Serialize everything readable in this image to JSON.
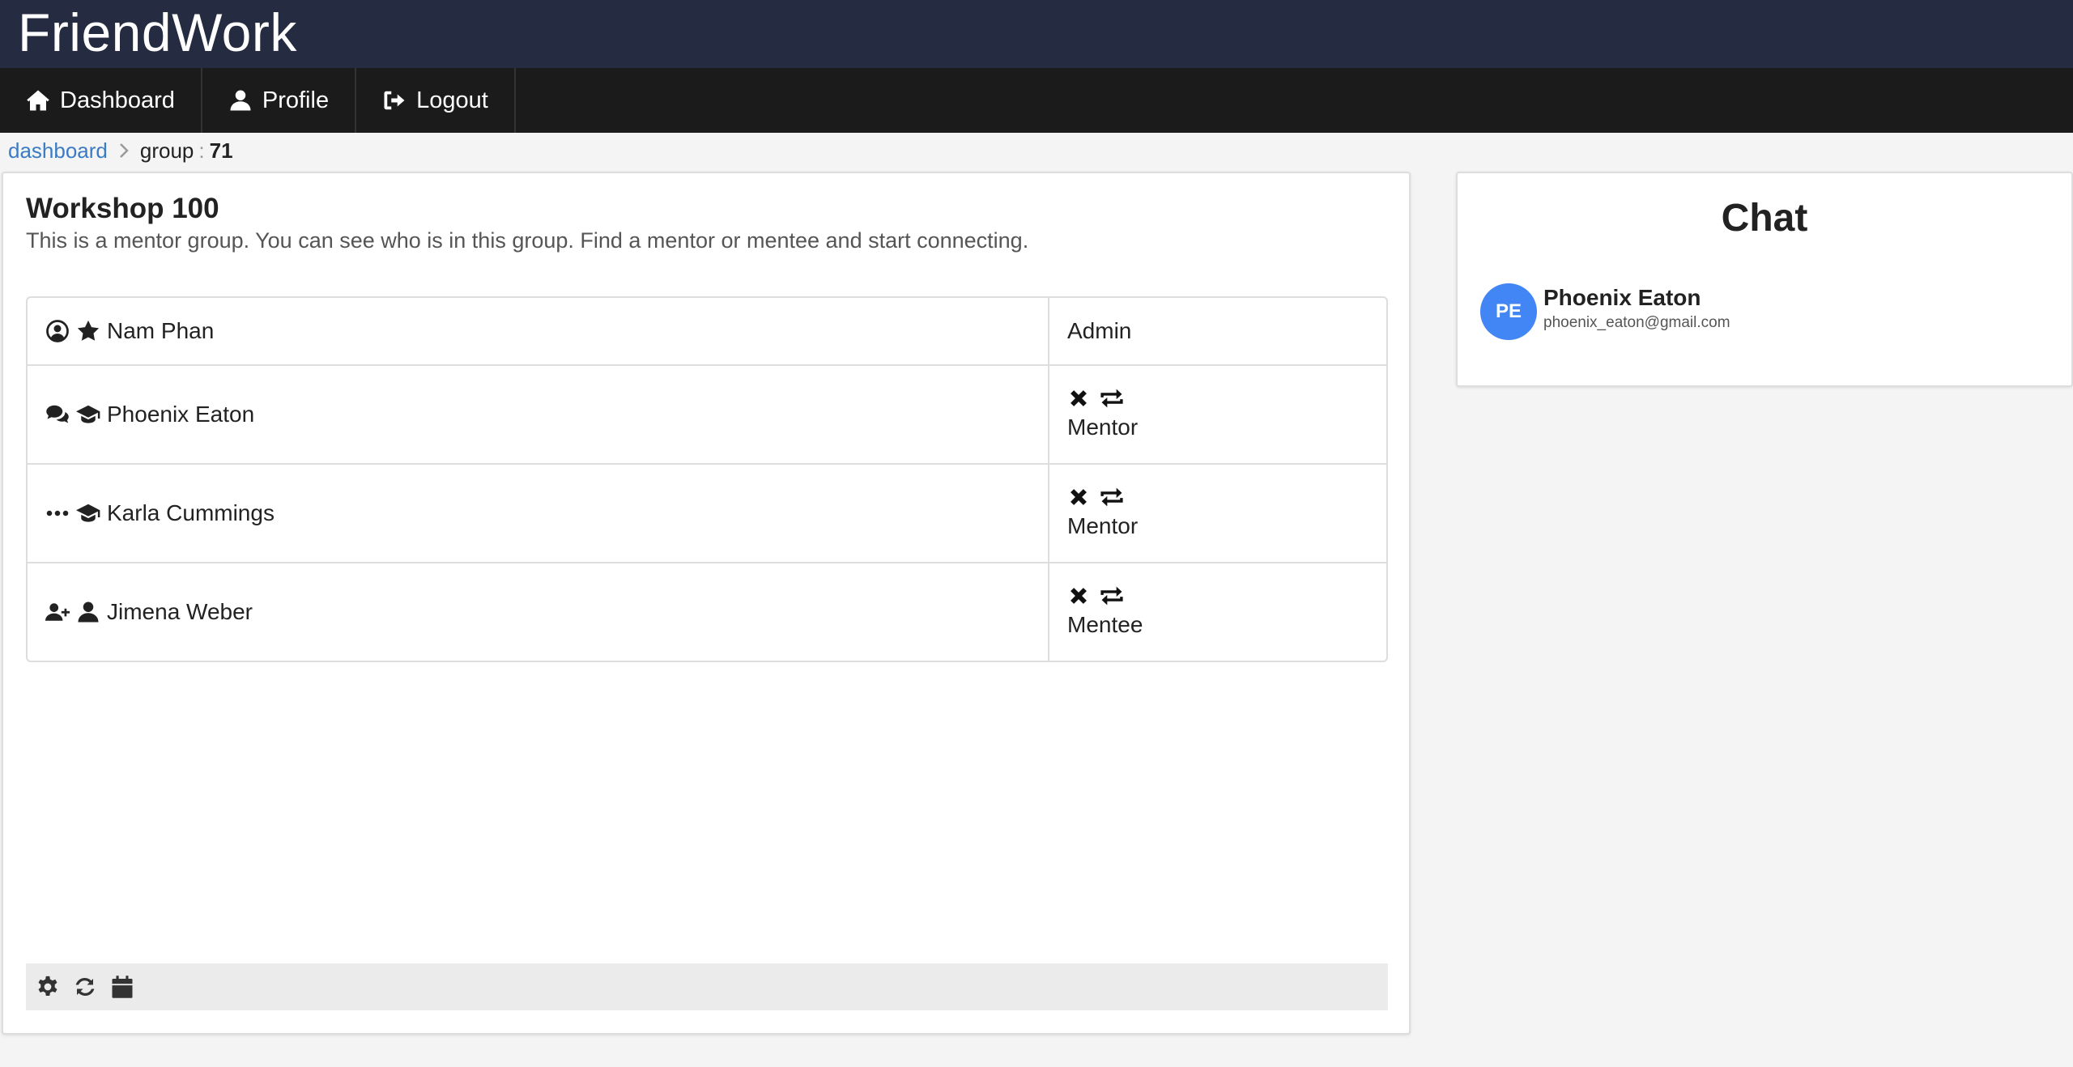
{
  "app": {
    "title": "FriendWork"
  },
  "nav": {
    "items": [
      {
        "label": "Dashboard",
        "icon": "home-icon"
      },
      {
        "label": "Profile",
        "icon": "user-icon"
      },
      {
        "label": "Logout",
        "icon": "sign-out-icon"
      }
    ]
  },
  "breadcrumb": {
    "link": "dashboard",
    "current": "group",
    "separator": ":",
    "id": "71"
  },
  "group": {
    "title": "Workshop 100",
    "description": "This is a mentor group. You can see who is in this group. Find a mentor or mentee and start connecting.",
    "members": [
      {
        "name": "Nam Phan",
        "role": "Admin",
        "status_icon": "user-circle-icon",
        "type_icon": "star-icon",
        "actions": []
      },
      {
        "name": "Phoenix Eaton",
        "role": "Mentor",
        "status_icon": "comments-icon",
        "type_icon": "graduation-cap-icon",
        "actions": [
          "remove-icon",
          "swap-icon"
        ]
      },
      {
        "name": "Karla Cummings",
        "role": "Mentor",
        "status_icon": "ellipsis-icon",
        "type_icon": "graduation-cap-icon",
        "actions": [
          "remove-icon",
          "swap-icon"
        ]
      },
      {
        "name": "Jimena Weber",
        "role": "Mentee",
        "status_icon": "user-plus-icon",
        "type_icon": "user-icon",
        "actions": [
          "remove-icon",
          "swap-icon"
        ]
      }
    ]
  },
  "footer": {
    "icons": [
      "gear-icon",
      "refresh-icon",
      "calendar-icon"
    ]
  },
  "chat": {
    "title": "Chat",
    "contacts": [
      {
        "initials": "PE",
        "name": "Phoenix Eaton",
        "email": "phoenix_eaton@gmail.com",
        "avatar_color": "#4285f4"
      }
    ]
  },
  "colors": {
    "topbar": "#252b40",
    "navbar": "#1b1b1b",
    "link": "#3a7bc4",
    "avatar": "#4285f4"
  }
}
